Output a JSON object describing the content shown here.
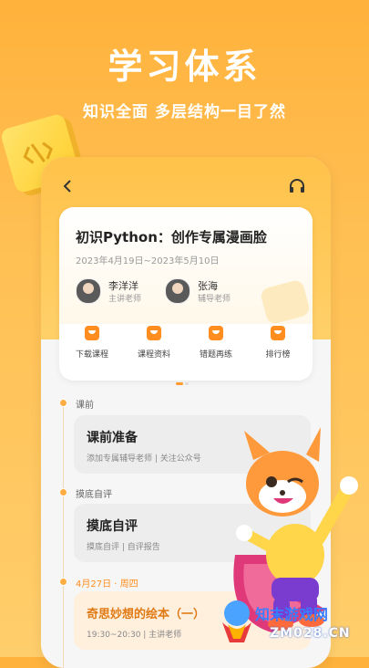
{
  "hero": {
    "title": "学习体系",
    "subtitle": "知识全面  多层结构一目了然"
  },
  "course": {
    "title": "初识Python：创作专属漫画脸",
    "date_range": "2023年4月19日~2023年5月10日",
    "teachers": [
      {
        "name": "李洋洋",
        "role": "主讲老师"
      },
      {
        "name": "张海",
        "role": "辅导老师"
      }
    ],
    "actions": [
      {
        "label": "下载课程",
        "icon": "download-icon"
      },
      {
        "label": "课程资料",
        "icon": "folder-icon"
      },
      {
        "label": "错题再练",
        "icon": "edit-icon"
      },
      {
        "label": "排行榜",
        "icon": "trophy-icon"
      }
    ]
  },
  "timeline": [
    {
      "label": "课前",
      "lesson_title": "课前准备",
      "lesson_sub": "添加专属辅导老师  |  关注公众号"
    },
    {
      "label": "摸底自评",
      "lesson_title": "摸底自评",
      "lesson_sub": "摸底自评  |  自评报告"
    },
    {
      "label": "4月27日 · 周四",
      "lesson_title": "奇思妙想的绘本（一）",
      "lesson_sub": "19:30~20:30  |  主讲老师"
    }
  ],
  "watermark": {
    "text": "知末游戏网",
    "url": "ZM028.CN"
  },
  "colors": {
    "accent": "#ff8d1f",
    "background": "#ffb23c",
    "card": "#ffffff"
  }
}
